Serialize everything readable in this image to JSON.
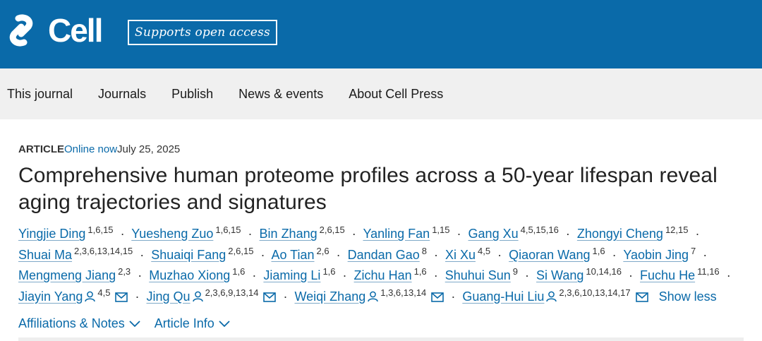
{
  "header": {
    "logo_text": "Cell",
    "badge": "Supports open access"
  },
  "nav": {
    "items": [
      "This journal",
      "Journals",
      "Publish",
      "News & events",
      "About Cell Press"
    ]
  },
  "article": {
    "type": "ARTICLE",
    "status": "Online now",
    "date": "July 25, 2025",
    "title": "Comprehensive human proteome profiles across a 50-year lifespan reveal aging trajectories and signatures",
    "show_less": "Show less",
    "affiliations_link": "Affiliations & Notes",
    "article_info_link": "Article Info"
  },
  "authors": [
    {
      "name": "Yingjie Ding",
      "sup": "1,6,15",
      "corresponding": false
    },
    {
      "name": "Yuesheng Zuo",
      "sup": "1,6,15",
      "corresponding": false
    },
    {
      "name": "Bin Zhang",
      "sup": "2,6,15",
      "corresponding": false
    },
    {
      "name": "Yanling Fan",
      "sup": "1,15",
      "corresponding": false
    },
    {
      "name": "Gang Xu",
      "sup": "4,5,15,16",
      "corresponding": false
    },
    {
      "name": "Zhongyi Cheng",
      "sup": "12,15",
      "corresponding": false
    },
    {
      "name": "Shuai Ma",
      "sup": "2,3,6,13,14,15",
      "corresponding": false
    },
    {
      "name": "Shuaiqi Fang",
      "sup": "2,6,15",
      "corresponding": false
    },
    {
      "name": "Ao Tian",
      "sup": "2,6",
      "corresponding": false
    },
    {
      "name": "Dandan Gao",
      "sup": "8",
      "corresponding": false
    },
    {
      "name": "Xi Xu",
      "sup": "4,5",
      "corresponding": false
    },
    {
      "name": "Qiaoran Wang",
      "sup": "1,6",
      "corresponding": false
    },
    {
      "name": "Yaobin Jing",
      "sup": "7",
      "corresponding": false
    },
    {
      "name": "Mengmeng Jiang",
      "sup": "2,3",
      "corresponding": false
    },
    {
      "name": "Muzhao Xiong",
      "sup": "1,6",
      "corresponding": false
    },
    {
      "name": "Jiaming Li",
      "sup": "1,6",
      "corresponding": false
    },
    {
      "name": "Zichu Han",
      "sup": "1,6",
      "corresponding": false
    },
    {
      "name": "Shuhui Sun",
      "sup": "9",
      "corresponding": false
    },
    {
      "name": "Si Wang",
      "sup": "10,14,16",
      "corresponding": false
    },
    {
      "name": "Fuchu He",
      "sup": "11,16",
      "corresponding": false
    },
    {
      "name": "Jiayin Yang",
      "sup": "4,5",
      "corresponding": true
    },
    {
      "name": "Jing Qu",
      "sup": "2,3,6,9,13,14",
      "corresponding": true
    },
    {
      "name": "Weiqi Zhang",
      "sup": "1,3,6,13,14",
      "corresponding": true
    },
    {
      "name": "Guang-Hui Liu",
      "sup": "2,3,6,10,13,14,17",
      "corresponding": true
    }
  ],
  "icons": {
    "corresponding": "person-icon",
    "email": "mail-icon",
    "expand": "chevron-down-icon"
  },
  "colors": {
    "brand_blue": "#0a6aa9",
    "nav_bg": "#f0f0f0",
    "link_blue": "#0a6aa9"
  }
}
